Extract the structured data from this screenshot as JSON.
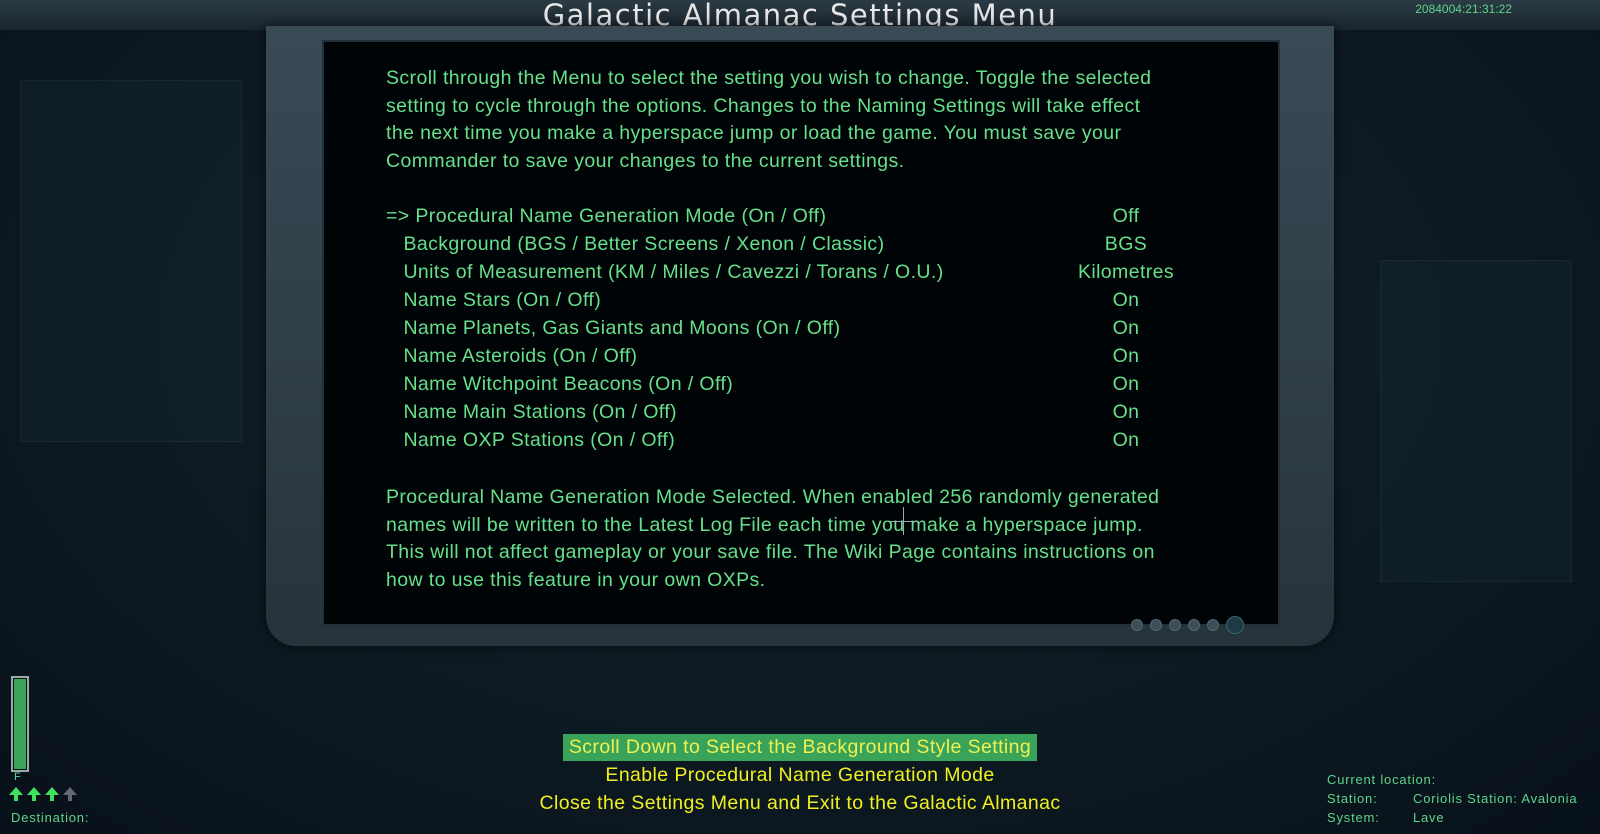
{
  "header": {
    "title": "Galactic Almanac Settings Menu",
    "clock": "2084004:21:31:22"
  },
  "intro": [
    "Scroll through the Menu to select the setting you wish to change. Toggle the selected",
    "setting to cycle through the options. Changes to the Naming Settings will take effect",
    "the next time you make a hyperspace jump or load the game. You must save your",
    "Commander to save your changes to the current settings."
  ],
  "settings": [
    {
      "label": "=> Procedural Name Generation Mode (On / Off)",
      "value": "Off"
    },
    {
      "label": "   Background (BGS / Better Screens / Xenon / Classic)",
      "value": "BGS"
    },
    {
      "label": "   Units of Measurement (KM / Miles / Cavezzi / Torans / O.U.)",
      "value": "Kilometres"
    },
    {
      "label": "   Name Stars (On / Off)",
      "value": "On"
    },
    {
      "label": "   Name Planets, Gas Giants and Moons (On / Off)",
      "value": "On"
    },
    {
      "label": "   Name Asteroids (On / Off)",
      "value": "On"
    },
    {
      "label": "   Name Witchpoint Beacons (On / Off)",
      "value": "On"
    },
    {
      "label": "   Name Main Stations (On / Off)",
      "value": "On"
    },
    {
      "label": "   Name OXP Stations (On / Off)",
      "value": "On"
    }
  ],
  "description": [
    "Procedural Name Generation Mode Selected. When enabled 256 randomly generated",
    "names will be written to the Latest Log File each time you make a hyperspace jump.",
    "This will not affect gameplay or your save file. The Wiki Page contains instructions on",
    "how to use this feature in your own OXPs."
  ],
  "menu": {
    "selected": "Scroll Down to Select the Background Style Setting",
    "option1": "Enable Procedural Name Generation Mode",
    "option2": "Close the Settings Menu and Exit to the Galactic Almanac"
  },
  "hud": {
    "fuel_label": "F",
    "fuel_level_fraction": 1.0,
    "destination_label": "Destination:",
    "current_location_label": "Current location:",
    "station_label": "Station:",
    "station_value": "Coriolis Station: Avalonia",
    "system_label": "System:",
    "system_value": "Lave"
  },
  "colors": {
    "text_green": "#66e08a",
    "menu_yellow": "#f0f020",
    "menu_highlight": "#3aa35a"
  }
}
